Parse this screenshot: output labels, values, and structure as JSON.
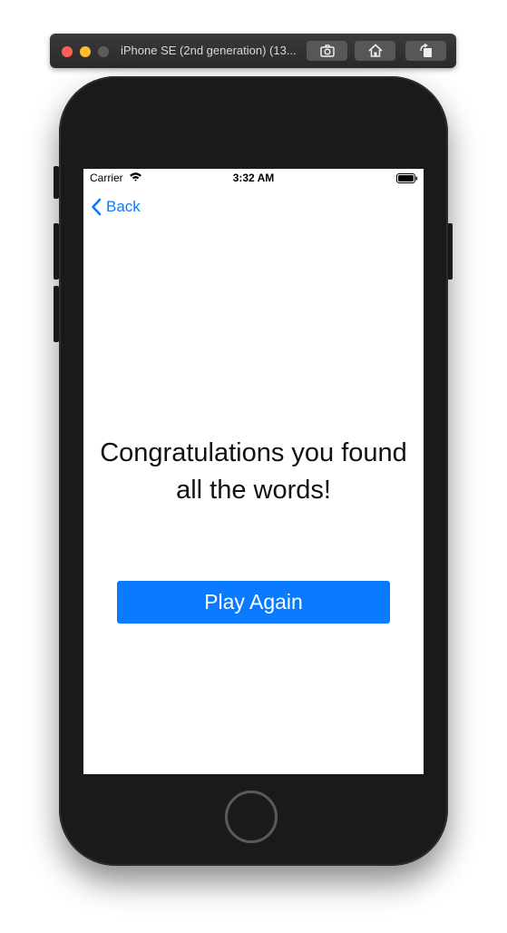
{
  "simulator": {
    "title": "iPhone SE (2nd generation) (13...",
    "toolbar": {
      "screenshot_icon": "camera-icon",
      "home_icon": "home-icon",
      "rotate_icon": "rotate-icon"
    }
  },
  "status_bar": {
    "carrier": "Carrier",
    "time": "3:32 AM",
    "wifi_icon": "wifi-icon",
    "battery_icon": "battery-icon"
  },
  "nav": {
    "back_label": "Back",
    "back_icon": "chevron-left-icon"
  },
  "content": {
    "message_line1": "Congratulations you found",
    "message_line2": "all the words!",
    "play_again_label": "Play Again"
  },
  "colors": {
    "accent": "#0a7aff",
    "button_text": "#ffffff",
    "screen_background": "#ffffff",
    "device_body": "#1a1a1a"
  }
}
